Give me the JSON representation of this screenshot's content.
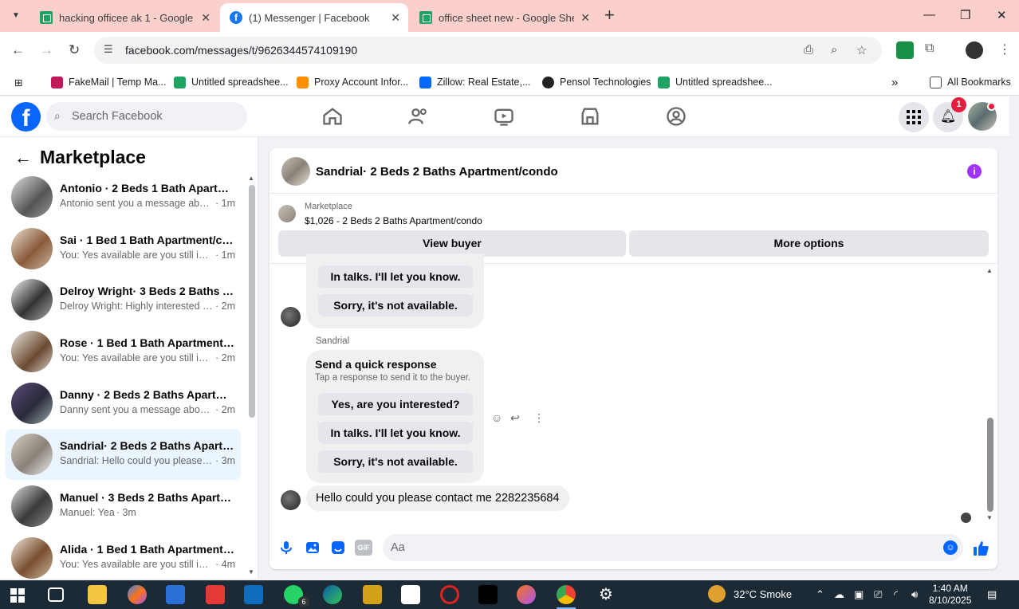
{
  "browser": {
    "tabs": [
      {
        "title": "hacking officee ak 1 - Google S",
        "favicon": "sheets-icon"
      },
      {
        "title": "(1) Messenger | Facebook",
        "favicon": "facebook-icon"
      },
      {
        "title": "office sheet new - Google Shee",
        "favicon": "sheets-icon"
      }
    ],
    "url": "facebook.com/messages/t/9626344574109190",
    "bookmarks": [
      "FakeMail | Temp Ma...",
      "Untitled spreadshee...",
      "Proxy Account Infor...",
      "Zillow: Real Estate,...",
      "Pensol Technologies",
      "Untitled spreadshee..."
    ],
    "all_bookmarks": "All Bookmarks"
  },
  "fb": {
    "search_placeholder": "Search Facebook",
    "notifications_count": "1"
  },
  "sidebar": {
    "title": "Marketplace",
    "conversations": [
      {
        "name": "Antonio · 2 Beds 1 Bath Apartm...",
        "preview": "Antonio sent you a message abou...",
        "time": " · 1m"
      },
      {
        "name": "Sai · 1 Bed 1 Bath Apartment/co...",
        "preview": "You: Yes available are you still inter...",
        "time": " · 1m"
      },
      {
        "name": "Delroy Wright· 3 Beds 2 Baths A...",
        "preview": "Delroy Wright: Highly interested p...",
        "time": " · 2m"
      },
      {
        "name": "Rose · 1 Bed 1 Bath Apartment/c...",
        "preview": "You: Yes available are you still inter...",
        "time": " · 2m"
      },
      {
        "name": "Danny · 2 Beds 2 Baths Apartme...",
        "preview": "Danny sent you a message about ...",
        "time": " · 2m"
      },
      {
        "name": "Sandrial· 2 Beds 2 Baths Apartm...",
        "preview": "Sandrial: Hello could you please 2...",
        "time": " · 3m"
      },
      {
        "name": "Manuel · 3 Beds 2 Baths Apartm...",
        "preview": "Manuel: Yea",
        "time": " · 3m"
      },
      {
        "name": "Alida · 1 Bed 1 Bath Apartment/c...",
        "preview": "You: Yes available are you still inter...",
        "time": " · 4m"
      }
    ]
  },
  "chat": {
    "title": "Sandrial· 2 Beds 2 Baths Apartment/condo",
    "marketplace_label": "Marketplace",
    "listing": "$1,026 - 2 Beds 2 Baths Apartment/condo",
    "view_buyer": "View buyer",
    "more_options": "More options",
    "prev_quick": [
      "In talks. I'll let you know.",
      "Sorry, it's not available."
    ],
    "sender": "Sandrial",
    "quick_title": "Send a quick response",
    "quick_sub": "Tap a response to send it to the buyer.",
    "quick_options": [
      "Yes, are you interested?",
      "In talks. I'll let you know.",
      "Sorry, it's not available."
    ],
    "message": "Hello could you please contact me 2282235684",
    "composer_placeholder": "Aa"
  },
  "taskbar": {
    "weather": "32°C  Smoke",
    "whatsapp_badge": "6",
    "time": "1:40 AM",
    "date": "8/10/2025"
  },
  "colors": {
    "fb_blue": "#0866ff",
    "selected_row": "#ebf5ff",
    "tab_strip": "#fbd0cc"
  }
}
